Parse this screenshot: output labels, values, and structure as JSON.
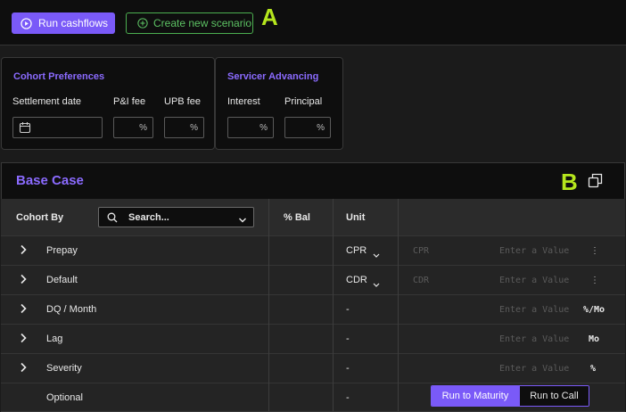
{
  "toolbar": {
    "run_label": "Run cashflows",
    "create_label": "Create new scenario",
    "marker_a": "A"
  },
  "cohort_preferences": {
    "title": "Cohort Preferences",
    "settlement_label": "Settlement date",
    "pi_fee_label": "P&I fee",
    "upb_fee_label": "UPB fee",
    "pct_symbol": "%"
  },
  "servicer_advancing": {
    "title": "Servicer Advancing",
    "interest_label": "Interest",
    "principal_label": "Principal",
    "pct_symbol": "%"
  },
  "base_case": {
    "title": "Base Case",
    "marker_b": "B",
    "columns": {
      "cohort_by": "Cohort By",
      "pct_bal": "% Bal",
      "unit": "Unit"
    },
    "search_placeholder": "Search...",
    "rows": [
      {
        "label": "Prepay",
        "unit": "CPR",
        "unit_placeholder": "CPR",
        "value_placeholder": "Enter a Value",
        "suffix": "⋮"
      },
      {
        "label": "Default",
        "unit": "CDR",
        "unit_placeholder": "CDR",
        "value_placeholder": "Enter a Value",
        "suffix": "⋮"
      },
      {
        "label": "DQ / Month",
        "unit": "-",
        "value_placeholder": "Enter a Value",
        "suffix": "%/Mo"
      },
      {
        "label": "Lag",
        "unit": "-",
        "value_placeholder": "Enter a Value",
        "suffix": "Mo"
      },
      {
        "label": "Severity",
        "unit": "-",
        "value_placeholder": "Enter a Value",
        "suffix": "%"
      },
      {
        "label": "Optional",
        "unit": "-"
      }
    ],
    "run_to_maturity": "Run to Maturity",
    "run_to_call": "Run to Call"
  }
}
